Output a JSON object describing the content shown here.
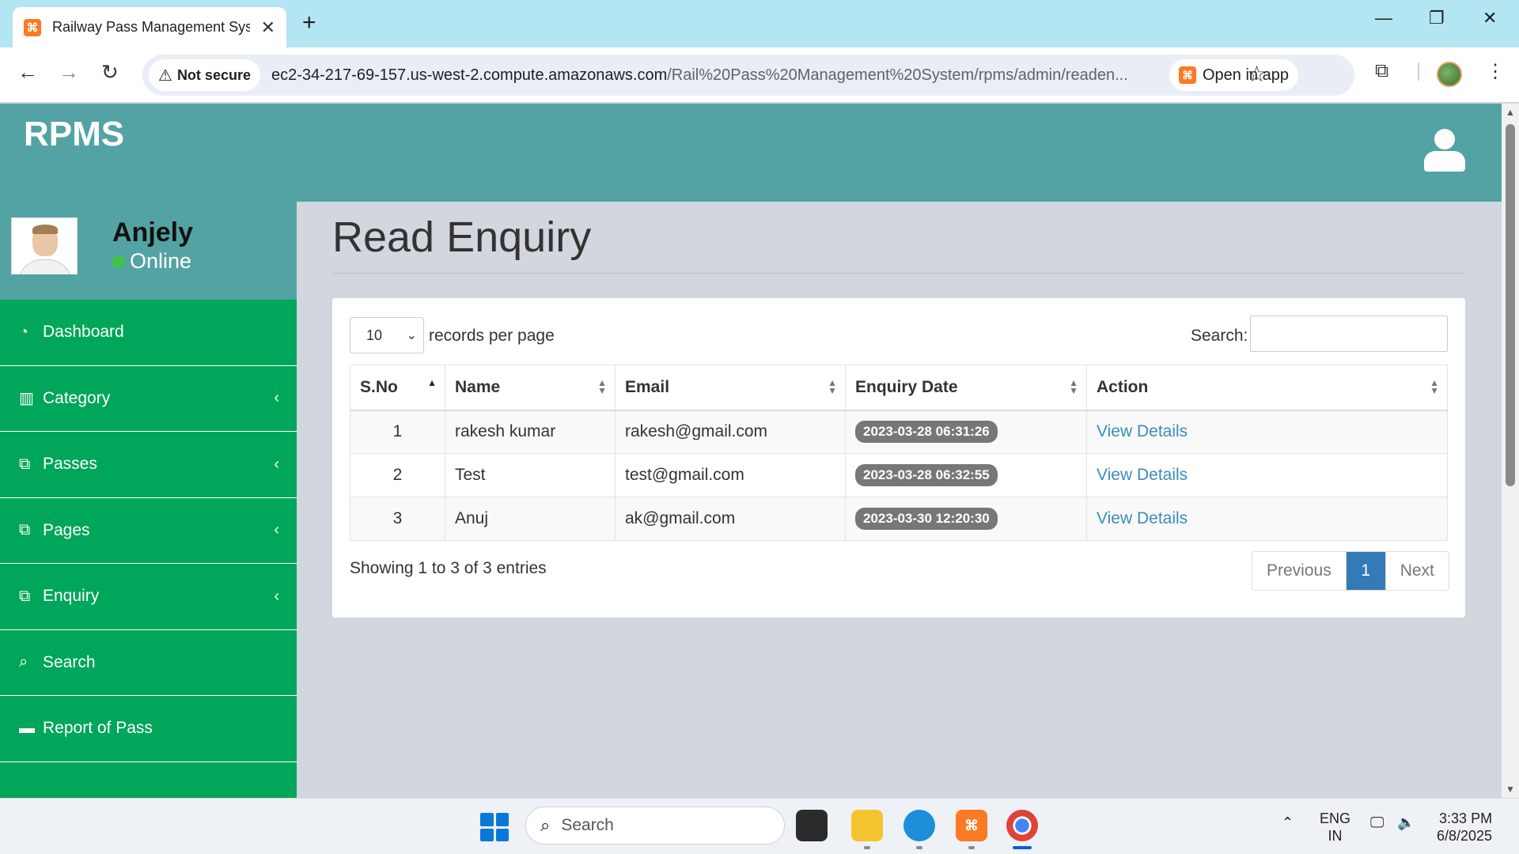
{
  "browser": {
    "tab_title": "Railway Pass Management Syste",
    "favicon_letter": "⌘",
    "new_tab": "+",
    "security_label": "Not secure",
    "url_main": "ec2-34-217-69-157.us-west-2.compute.amazonaws.com",
    "url_path": "/Rail%20Pass%20Management%20System/rpms/admin/readen...",
    "open_in_app": "Open in app"
  },
  "app": {
    "brand": "RPMS",
    "user": {
      "name": "Anjely",
      "status": "Online"
    },
    "menu": [
      {
        "label": "Dashboard",
        "icon": "◔",
        "has_caret": false
      },
      {
        "label": "Category",
        "icon": "▥",
        "has_caret": true
      },
      {
        "label": "Passes",
        "icon": "⧉",
        "has_caret": true
      },
      {
        "label": "Pages",
        "icon": "⧉",
        "has_caret": true
      },
      {
        "label": "Enquiry",
        "icon": "⧉",
        "has_caret": true
      },
      {
        "label": "Search",
        "icon": "⌕",
        "has_caret": false
      },
      {
        "label": "Report of Pass",
        "icon": "▬",
        "has_caret": false
      }
    ]
  },
  "page": {
    "title": "Read Enquiry",
    "length_value": "10",
    "length_label": "records per page",
    "search_label": "Search:",
    "columns": [
      "S.No",
      "Name",
      "Email",
      "Enquiry Date",
      "Action"
    ],
    "rows": [
      {
        "sno": "1",
        "name": "rakesh kumar",
        "email": "rakesh@gmail.com",
        "date": "2023-03-28 06:31:26",
        "action": "View Details"
      },
      {
        "sno": "2",
        "name": "Test",
        "email": "test@gmail.com",
        "date": "2023-03-28 06:32:55",
        "action": "View Details"
      },
      {
        "sno": "3",
        "name": "Anuj",
        "email": "ak@gmail.com",
        "date": "2023-03-30 12:20:30",
        "action": "View Details"
      }
    ],
    "info": "Showing 1 to 3 of 3 entries",
    "pager": {
      "previous": "Previous",
      "current": "1",
      "next": "Next"
    }
  },
  "taskbar": {
    "search_placeholder": "Search",
    "lang_top": "ENG",
    "lang_bottom": "IN",
    "time": "3:33 PM",
    "date": "6/8/2025"
  },
  "colors": {
    "header": "#54a3a4",
    "sidebar": "#00a65a",
    "link": "#3c8dbc",
    "pager_active": "#337ab7",
    "badge": "#777777"
  }
}
